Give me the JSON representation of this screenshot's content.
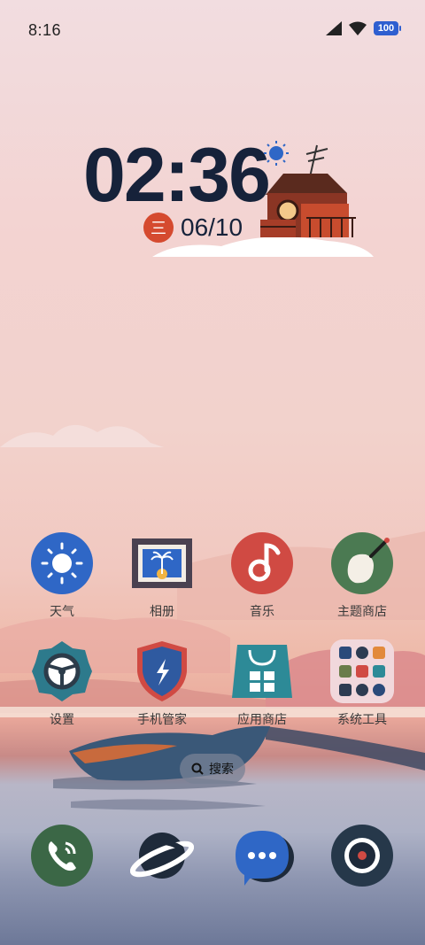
{
  "status_bar": {
    "time": "8:16",
    "battery_level": "100",
    "icons": [
      "signal-icon",
      "wifi-icon",
      "battery-icon"
    ]
  },
  "widget": {
    "time": "02:36",
    "weekday": "三",
    "date": "06/10"
  },
  "apps": [
    {
      "label": "天气",
      "icon": "weather-icon"
    },
    {
      "label": "相册",
      "icon": "gallery-icon"
    },
    {
      "label": "音乐",
      "icon": "music-icon"
    },
    {
      "label": "主题商店",
      "icon": "theme-store-icon"
    },
    {
      "label": "设置",
      "icon": "settings-icon"
    },
    {
      "label": "手机管家",
      "icon": "phone-manager-icon"
    },
    {
      "label": "应用商店",
      "icon": "app-store-icon"
    },
    {
      "label": "系统工具",
      "icon": "system-tools-folder-icon"
    }
  ],
  "search": {
    "label": "搜索"
  },
  "dock": [
    {
      "icon": "phone-icon"
    },
    {
      "icon": "browser-icon"
    },
    {
      "icon": "messages-icon"
    },
    {
      "icon": "camera-icon"
    }
  ],
  "colors": {
    "accent_blue": "#2f5fd0",
    "badge_red": "#d54a2f"
  }
}
